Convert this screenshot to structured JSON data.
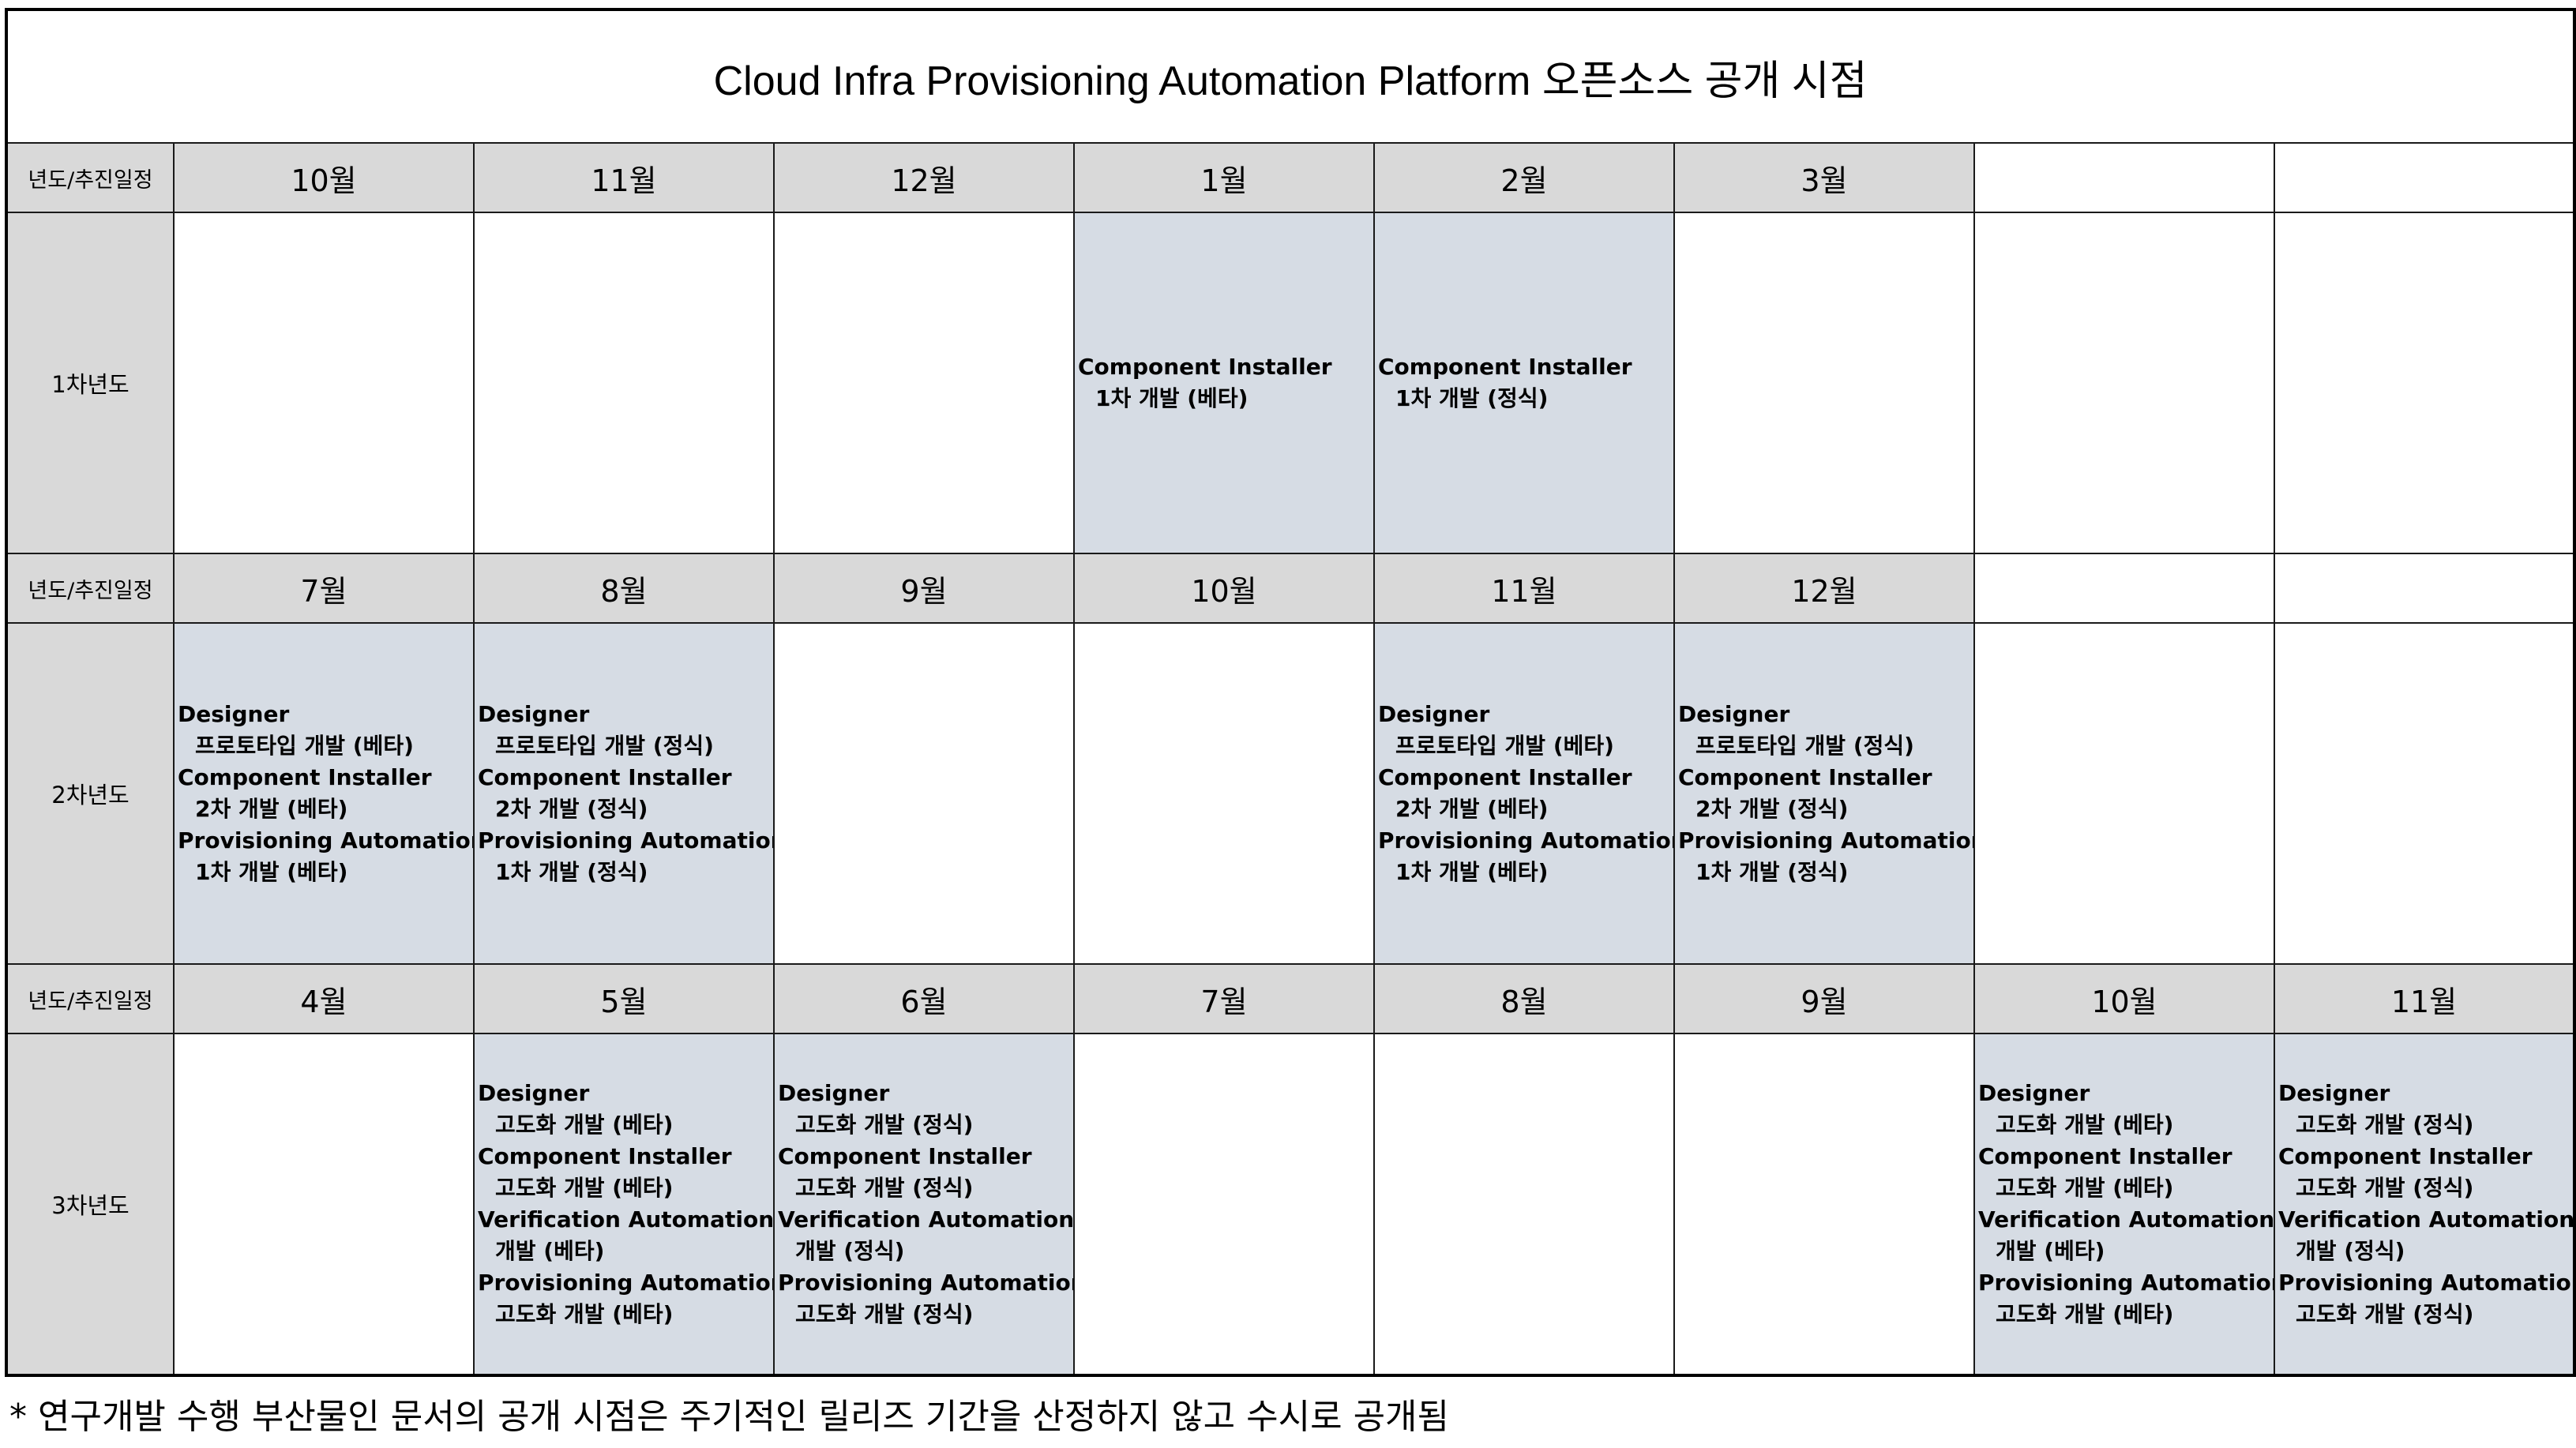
{
  "title": "Cloud Infra Provisioning Automation Platform 오픈소스 공개 시점",
  "row_header_label": "년도/추진일정",
  "years": [
    {
      "label": "1차년도",
      "months": [
        "10월",
        "11월",
        "12월",
        "1월",
        "2월",
        "3월",
        "",
        ""
      ],
      "cells": [
        [],
        [],
        [],
        [
          {
            "name": "Component Installer",
            "sub": "1차 개발 (베타)"
          }
        ],
        [
          {
            "name": "Component Installer",
            "sub": "1차 개발 (정식)"
          }
        ],
        [],
        [],
        []
      ]
    },
    {
      "label": "2차년도",
      "months": [
        "7월",
        "8월",
        "9월",
        "10월",
        "11월",
        "12월",
        "",
        ""
      ],
      "cells": [
        [
          {
            "name": "Designer",
            "sub": "프로토타입 개발 (베타)"
          },
          {
            "name": "Component Installer",
            "sub": "2차 개발 (베타)"
          },
          {
            "name": "Provisioning Automation",
            "sub": "1차 개발 (베타)"
          }
        ],
        [
          {
            "name": "Designer",
            "sub": "프로토타입 개발 (정식)"
          },
          {
            "name": "Component Installer",
            "sub": "2차 개발 (정식)"
          },
          {
            "name": "Provisioning Automation",
            "sub": "1차 개발 (정식)"
          }
        ],
        [],
        [],
        [
          {
            "name": "Designer",
            "sub": "프로토타입 개발 (베타)"
          },
          {
            "name": "Component Installer",
            "sub": "2차 개발 (베타)"
          },
          {
            "name": "Provisioning Automation",
            "sub": "1차 개발 (베타)"
          }
        ],
        [
          {
            "name": "Designer",
            "sub": "프로토타입 개발 (정식)"
          },
          {
            "name": "Component Installer",
            "sub": "2차 개발 (정식)"
          },
          {
            "name": "Provisioning Automation",
            "sub": "1차 개발 (정식)"
          }
        ],
        [],
        []
      ]
    },
    {
      "label": "3차년도",
      "months": [
        "4월",
        "5월",
        "6월",
        "7월",
        "8월",
        "9월",
        "10월",
        "11월"
      ],
      "cells": [
        [],
        [
          {
            "name": "Designer",
            "sub": "고도화 개발 (베타)"
          },
          {
            "name": "Component Installer",
            "sub": "고도화 개발 (베타)"
          },
          {
            "name": "Verification Automation",
            "sub": "개발 (베타)"
          },
          {
            "name": "Provisioning Automation",
            "sub": "고도화 개발 (베타)"
          }
        ],
        [
          {
            "name": "Designer",
            "sub": "고도화 개발 (정식)"
          },
          {
            "name": "Component Installer",
            "sub": "고도화 개발 (정식)"
          },
          {
            "name": "Verification Automation",
            "sub": "개발 (정식)"
          },
          {
            "name": "Provisioning Automation",
            "sub": "고도화 개발 (정식)"
          }
        ],
        [],
        [],
        [],
        [
          {
            "name": "Designer",
            "sub": "고도화 개발 (베타)"
          },
          {
            "name": "Component Installer",
            "sub": "고도화 개발 (베타)"
          },
          {
            "name": "Verification Automation",
            "sub": "개발 (베타)"
          },
          {
            "name": "Provisioning Automation",
            "sub": "고도화 개발 (베타)"
          }
        ],
        [
          {
            "name": "Designer",
            "sub": "고도화 개발 (정식)"
          },
          {
            "name": "Component Installer",
            "sub": "고도화 개발 (정식)"
          },
          {
            "name": "Verification Automation",
            "sub": "개발 (정식)"
          },
          {
            "name": "Provisioning Automation",
            "sub": "고도화 개발 (정식)"
          }
        ]
      ]
    }
  ],
  "footnote": "* 연구개발 수행 부산물인 문서의 공개 시점은 주기적인 릴리즈 기간을 산정하지 않고 수시로 공개됨",
  "colors": {
    "header_gray": "#d9d9d9",
    "filled_cell": "#d6dce4",
    "border": "#1a1a1a"
  }
}
